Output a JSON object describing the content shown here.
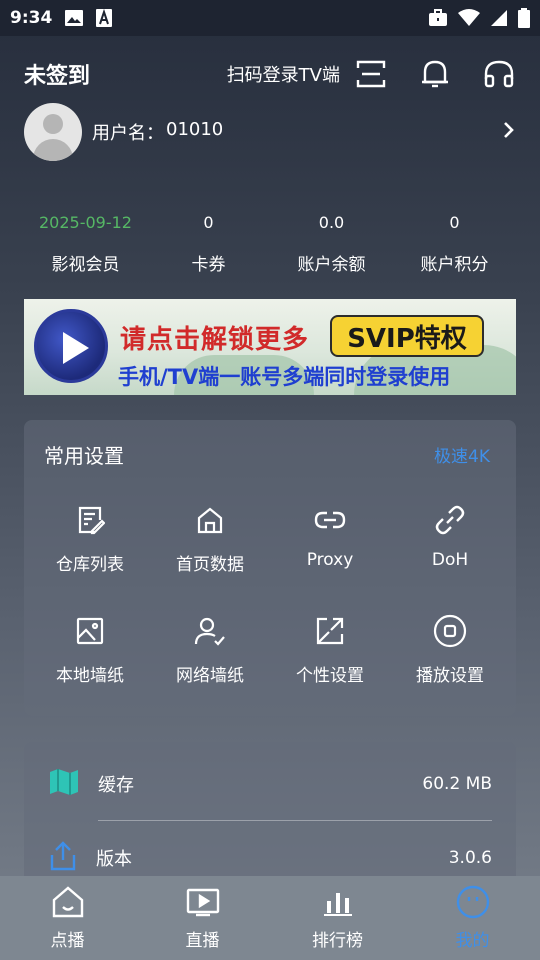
{
  "status_bar": {
    "time": "9:34",
    "icons": [
      "image-icon",
      "font-icon",
      "briefcase-icon",
      "wifi-icon",
      "signal-icon",
      "battery-icon"
    ]
  },
  "header": {
    "title": "未签到",
    "tv_login_label": "扫码登录TV端",
    "icons": [
      "scan-icon",
      "bell-icon",
      "headset-icon"
    ]
  },
  "profile": {
    "username_label": "用户名：",
    "username_value": "01010"
  },
  "stats": [
    {
      "value": "2025-09-12",
      "label": "影视会员"
    },
    {
      "value": "0",
      "label": "卡券"
    },
    {
      "value": "0.0",
      "label": "账户余额"
    },
    {
      "value": "0",
      "label": "账户积分"
    }
  ],
  "banner": {
    "line1": "请点击解锁更多",
    "badge": "SVIP特权",
    "line2": "手机/TV端一账号多端同时登录使用"
  },
  "settings": {
    "title": "常用设置",
    "extra": "极速4K",
    "items": [
      {
        "label": "仓库列表",
        "icon": "edit-note-icon"
      },
      {
        "label": "首页数据",
        "icon": "home-icon"
      },
      {
        "label": "Proxy",
        "icon": "link-icon"
      },
      {
        "label": "DoH",
        "icon": "chain-icon"
      },
      {
        "label": "本地墙纸",
        "icon": "image-icon"
      },
      {
        "label": "网络墙纸",
        "icon": "user-check-icon"
      },
      {
        "label": "个性设置",
        "icon": "expand-icon"
      },
      {
        "label": "播放设置",
        "icon": "stop-circle-icon"
      }
    ]
  },
  "info": {
    "cache_label": "缓存",
    "cache_value": "60.2 MB",
    "version_label": "版本",
    "version_value": "3.0.6"
  },
  "bottom_nav": [
    {
      "label": "点播",
      "icon": "home-smile-icon"
    },
    {
      "label": "直播",
      "icon": "play-box-icon"
    },
    {
      "label": "排行榜",
      "icon": "bar-chart-icon"
    },
    {
      "label": "我的",
      "icon": "smile-icon"
    }
  ],
  "colors": {
    "accent": "#3f8fe8",
    "vip_date": "#56b865",
    "cache_icon": "#2ec4b6"
  }
}
